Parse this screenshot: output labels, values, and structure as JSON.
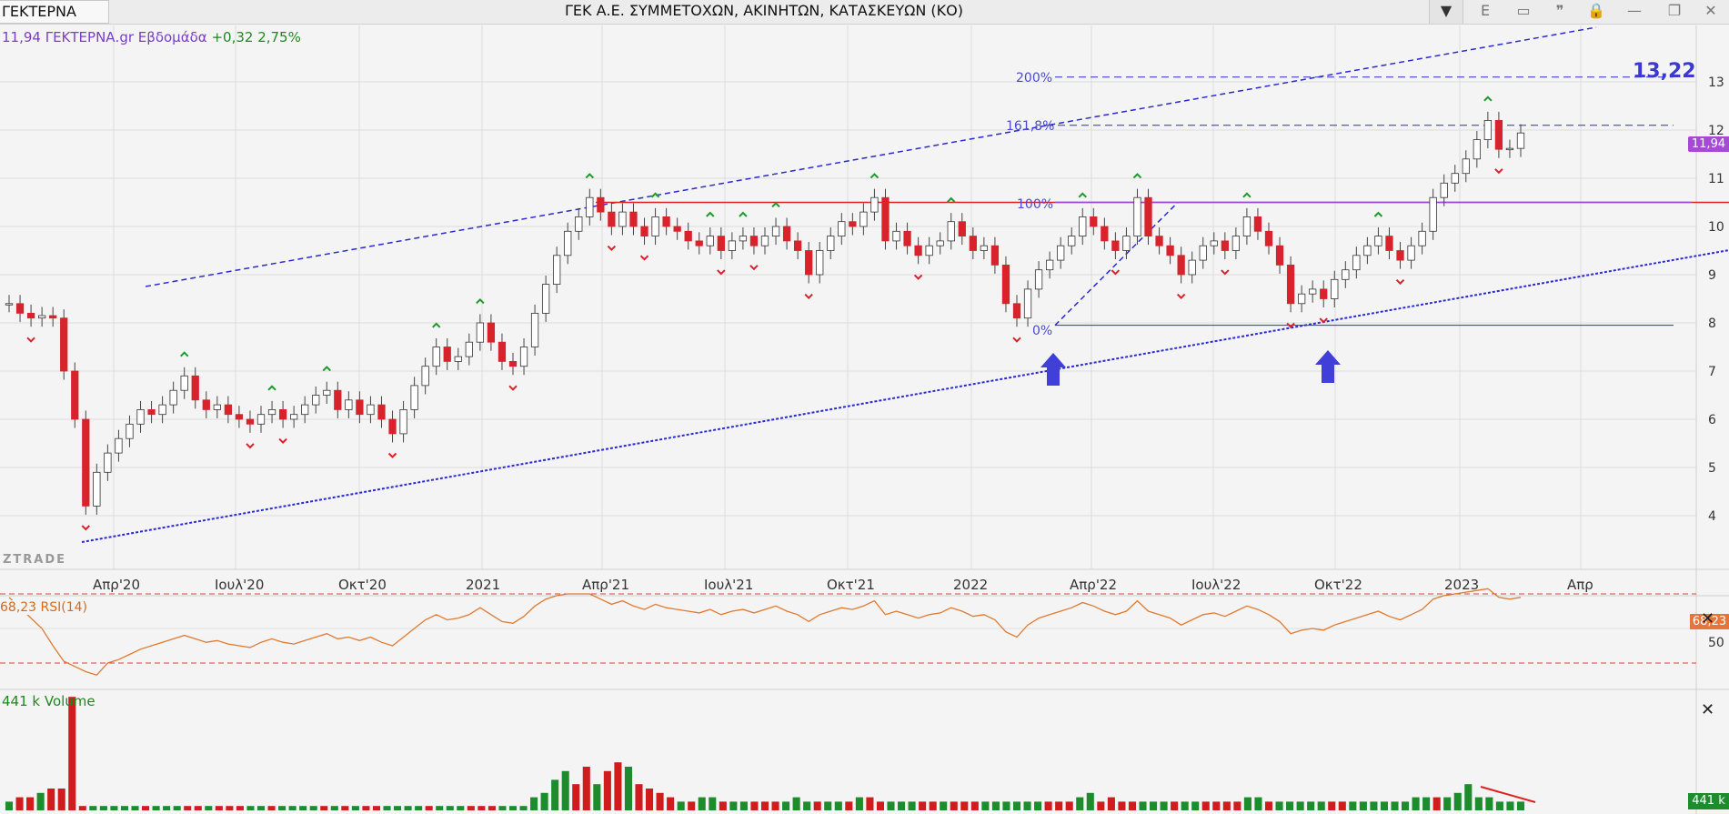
{
  "window": {
    "symbol": "ΓΕΚΤΕΡΝΑ",
    "title": "ΓΕΚ  Α.Ε. ΣΥΜΜΕΤΟΧΩΝ, ΑΚΙΝΗΤΩΝ, ΚΑΤΑΣΚΕΥΩΝ (ΚΟ)",
    "dropdown_glyph": "▼",
    "toolbar": [
      {
        "name": "e-button",
        "glyph": "E"
      },
      {
        "name": "window-button",
        "glyph": "▭"
      },
      {
        "name": "quote-button",
        "glyph": "❞"
      },
      {
        "name": "lock-button",
        "glyph": "🔒"
      },
      {
        "name": "minimize-button",
        "glyph": "—"
      },
      {
        "name": "restore-button",
        "glyph": "❐"
      },
      {
        "name": "close-button",
        "glyph": "✕"
      }
    ]
  },
  "chart": {
    "info_price": "11,94 ΓΕΚΤΕΡΝΑ.gr Εβδομάδα",
    "info_change": "+0,32 2,75%",
    "watermark": "ZTRADE",
    "fib_levels": [
      {
        "label": "200%",
        "value": 13.1
      },
      {
        "label": "161,8%",
        "value": 12.1
      },
      {
        "label": "100%",
        "value": 10.5
      },
      {
        "label": "0%",
        "value": 7.95
      }
    ],
    "target_label": "13,22",
    "price_tag": "11,94",
    "price_axis": [
      "13",
      "12",
      "11",
      "10",
      "9",
      "8",
      "7",
      "6",
      "5",
      "4"
    ],
    "time_axis": [
      "Απρ'20",
      "Ιουλ'20",
      "Οκτ'20",
      "2021",
      "Απρ'21",
      "Ιουλ'21",
      "Οκτ'21",
      "2022",
      "Απρ'22",
      "Ιουλ'22",
      "Οκτ'22",
      "2023",
      "Απρ"
    ],
    "colors": {
      "up": "#ffffff",
      "down": "#d8222c",
      "trend": "#2a2ad0",
      "resistance": "#e02020",
      "rsi": "#e07a30",
      "volume_up": "#1c8c2c",
      "volume_down": "#d01c1c"
    }
  },
  "rsi": {
    "title": "68,23 RSI(14)",
    "value_tag": "68,23",
    "mid_label": "50",
    "close_glyph": "✕"
  },
  "volume": {
    "title": "441 k Volume",
    "value_tag": "441 k",
    "close_glyph": "✕"
  },
  "chart_data": {
    "type": "candlestick",
    "interval": "weekly",
    "x_axis_ticks": [
      "Απρ'20",
      "Ιουλ'20",
      "Οκτ'20",
      "2021",
      "Απρ'21",
      "Ιουλ'21",
      "Οκτ'21",
      "2022",
      "Απρ'22",
      "Ιουλ'22",
      "Οκτ'22",
      "2023",
      "Απρ"
    ],
    "y_axis_ticks": [
      4,
      5,
      6,
      7,
      8,
      9,
      10,
      11,
      12,
      13
    ],
    "last_price": 11.94,
    "change": 0.32,
    "change_pct": 2.75,
    "close_series": [
      8.4,
      8.2,
      8.1,
      8.15,
      8.1,
      7.0,
      6.0,
      4.2,
      4.9,
      5.3,
      5.6,
      5.9,
      6.2,
      6.1,
      6.3,
      6.6,
      6.9,
      6.4,
      6.2,
      6.3,
      6.1,
      6.0,
      5.9,
      6.1,
      6.2,
      6.0,
      6.1,
      6.3,
      6.5,
      6.6,
      6.2,
      6.4,
      6.1,
      6.3,
      6.0,
      5.7,
      6.2,
      6.7,
      7.1,
      7.5,
      7.2,
      7.3,
      7.6,
      8.0,
      7.6,
      7.2,
      7.1,
      7.5,
      8.2,
      8.8,
      9.4,
      9.9,
      10.2,
      10.6,
      10.3,
      10.0,
      10.3,
      10.0,
      9.8,
      10.2,
      10.0,
      9.9,
      9.7,
      9.6,
      9.8,
      9.5,
      9.7,
      9.8,
      9.6,
      9.8,
      10.0,
      9.7,
      9.5,
      9.0,
      9.5,
      9.8,
      10.1,
      10.0,
      10.3,
      10.6,
      9.7,
      9.9,
      9.6,
      9.4,
      9.6,
      9.7,
      10.1,
      9.8,
      9.5,
      9.6,
      9.2,
      8.4,
      8.1,
      8.7,
      9.1,
      9.3,
      9.6,
      9.8,
      10.2,
      10.0,
      9.7,
      9.5,
      9.8,
      10.6,
      9.8,
      9.6,
      9.4,
      9.0,
      9.3,
      9.6,
      9.7,
      9.5,
      9.8,
      10.2,
      9.9,
      9.6,
      9.2,
      8.4,
      8.6,
      8.7,
      8.5,
      8.9,
      9.1,
      9.4,
      9.6,
      9.8,
      9.5,
      9.3,
      9.6,
      9.9,
      10.6,
      10.9,
      11.1,
      11.4,
      11.8,
      12.2,
      11.6,
      11.62,
      11.94
    ],
    "volume_series": [
      20,
      30,
      30,
      40,
      50,
      50,
      260,
      10,
      10,
      10,
      10,
      10,
      10,
      10,
      10,
      10,
      10,
      10,
      10,
      10,
      10,
      10,
      10,
      10,
      10,
      10,
      10,
      10,
      10,
      10,
      10,
      10,
      10,
      10,
      10,
      10,
      10,
      10,
      10,
      10,
      10,
      10,
      10,
      10,
      10,
      10,
      10,
      10,
      10,
      10,
      30,
      40,
      70,
      90,
      60,
      100,
      60,
      90,
      110,
      100,
      60,
      50,
      40,
      30,
      20,
      20,
      30,
      30,
      20,
      20,
      20,
      20,
      20,
      20,
      20,
      30,
      20,
      20,
      20,
      20,
      20,
      30,
      30,
      20,
      20,
      20,
      20,
      20,
      20,
      20,
      20,
      20,
      20,
      20,
      20,
      20,
      20,
      20,
      20,
      20,
      20,
      20,
      30,
      40,
      20,
      30,
      20,
      20,
      20,
      20,
      20,
      20,
      20,
      20,
      20,
      20,
      20,
      20,
      30,
      30,
      20,
      20,
      20,
      20,
      20,
      20,
      20,
      20,
      20,
      20,
      20,
      20,
      20,
      20,
      30,
      30,
      30,
      30,
      40,
      60,
      30,
      30,
      20,
      20,
      20
    ],
    "rsi_series": [
      68,
      62,
      56,
      50,
      40,
      31,
      28,
      25,
      23,
      30,
      32,
      35,
      38,
      40,
      42,
      44,
      46,
      44,
      42,
      43,
      41,
      40,
      39,
      42,
      44,
      42,
      41,
      43,
      45,
      47,
      44,
      45,
      43,
      45,
      42,
      40,
      45,
      50,
      55,
      58,
      55,
      56,
      58,
      62,
      58,
      54,
      53,
      57,
      63,
      67,
      69,
      70,
      70,
      70,
      67,
      64,
      66,
      63,
      61,
      64,
      62,
      61,
      60,
      59,
      61,
      58,
      60,
      61,
      59,
      61,
      63,
      60,
      58,
      54,
      58,
      60,
      62,
      61,
      63,
      66,
      58,
      60,
      58,
      56,
      58,
      59,
      62,
      60,
      57,
      58,
      55,
      48,
      45,
      52,
      56,
      58,
      60,
      62,
      65,
      63,
      60,
      58,
      60,
      66,
      60,
      58,
      56,
      52,
      55,
      58,
      59,
      57,
      60,
      63,
      61,
      58,
      54,
      47,
      49,
      50,
      49,
      52,
      54,
      56,
      58,
      60,
      57,
      55,
      58,
      61,
      67,
      69,
      70,
      71,
      72,
      73,
      68,
      67,
      68
    ],
    "rsi_levels": [
      70,
      30
    ],
    "fibonacci": {
      "0%": 7.95,
      "100%": 10.5,
      "161,8%": 12.1,
      "200%": 13.1
    },
    "target": 13.22,
    "resistance_level": 10.5
  }
}
